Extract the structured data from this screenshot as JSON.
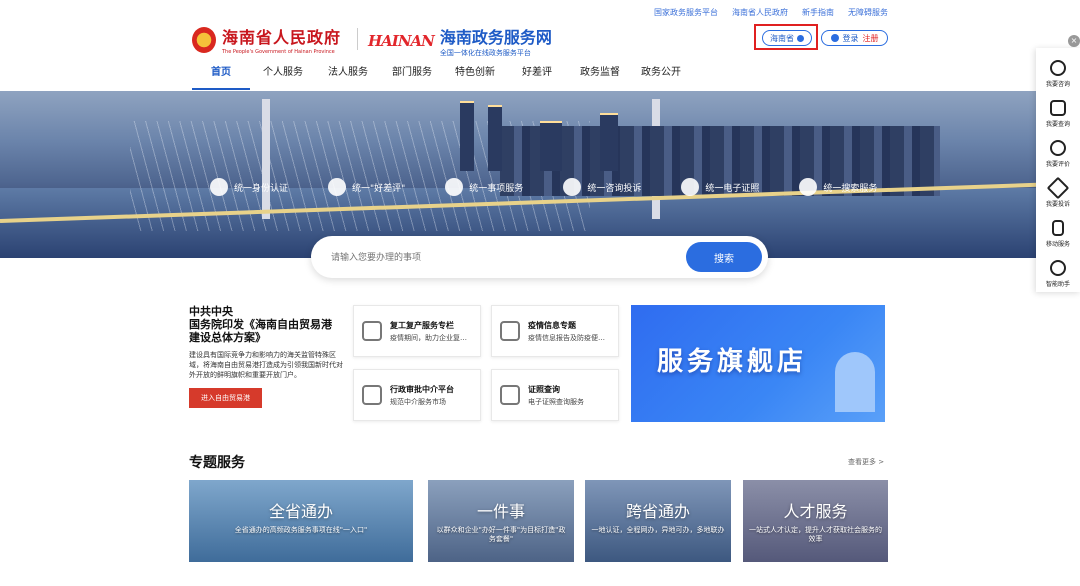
{
  "top_links": [
    "国家政务服务平台",
    "海南省人民政府",
    "新手指南",
    "无障碍服务"
  ],
  "logo_gov": {
    "cn": "海南省人民政府",
    "en": "The People's Government of Hainan Province"
  },
  "logo_service": {
    "mark": "HAINAN",
    "cn": "海南政务服务网",
    "sub": "全国一体化在线政务服务平台"
  },
  "region_label": "海南省",
  "login_label": "登录",
  "register_label": "注册",
  "nav": [
    "首页",
    "个人服务",
    "法人服务",
    "部门服务",
    "特色创新",
    "好差评",
    "政务监督",
    "政务公开"
  ],
  "features": [
    {
      "label": "统一身份认证",
      "icon": "id-person-icon"
    },
    {
      "label": "统一\"好差评\"",
      "icon": "smile-icon"
    },
    {
      "label": "统一事项服务",
      "icon": "list-card-icon"
    },
    {
      "label": "统一咨询投诉",
      "icon": "chat-icon"
    },
    {
      "label": "统一电子证照",
      "icon": "license-icon"
    },
    {
      "label": "统一搜索服务",
      "icon": "search-icon"
    }
  ],
  "search": {
    "placeholder": "请输入您要办理的事项",
    "button": "搜索"
  },
  "news": {
    "line1": "中共中央",
    "line2": "国务院印发《海南自由贸易港",
    "line3": "建设总体方案》",
    "body": "建设具有国际竞争力和影响力的海关监管特殊区域，将海南自由贸易港打造成为引领我国新时代对外开放的鲜明旗帜和重要开放门户。",
    "button": "进入自由贸易港"
  },
  "cards": [
    {
      "title": "复工复产服务专栏",
      "sub": "疫情期间，助力企业复…",
      "icon": "shield-gear-icon"
    },
    {
      "title": "疫情信息专题",
      "sub": "疫情信息报告及防疫便…",
      "icon": "report-icon"
    },
    {
      "title": "行政审批中介平台",
      "sub": "规范中介服务市场",
      "icon": "drop-icon"
    },
    {
      "title": "证照查询",
      "sub": "电子证照查询服务",
      "icon": "building-icon"
    }
  ],
  "flagship": "服务旗舰店",
  "topic": {
    "title": "专题服务",
    "more": "查看更多 >"
  },
  "tiles": [
    {
      "title": "全省通办",
      "sub": "全省通办的高频政务服务事项在线\"一入口\""
    },
    {
      "title": "一件事",
      "sub": "以群众和企业\"办好一件事\"为目标打造\"政务套餐\""
    },
    {
      "title": "跨省通办",
      "sub": "一地认证，全程网办，异地可办，多地联办"
    },
    {
      "title": "人才服务",
      "sub": "一站式人才认定，提升人才获取社会服务的效率"
    }
  ],
  "sidebar": [
    "我要咨询",
    "我要查询",
    "我要评价",
    "我要投诉",
    "移动服务",
    "智能助手"
  ],
  "sidebar_icons": [
    "chat-bubble-icon",
    "doc-search-icon",
    "star-badge-icon",
    "pen-icon",
    "phone-icon",
    "robot-icon"
  ],
  "colors": {
    "brand_blue": "#2b6de0",
    "gov_red": "#c8161d",
    "highlight_red": "#e02020"
  }
}
